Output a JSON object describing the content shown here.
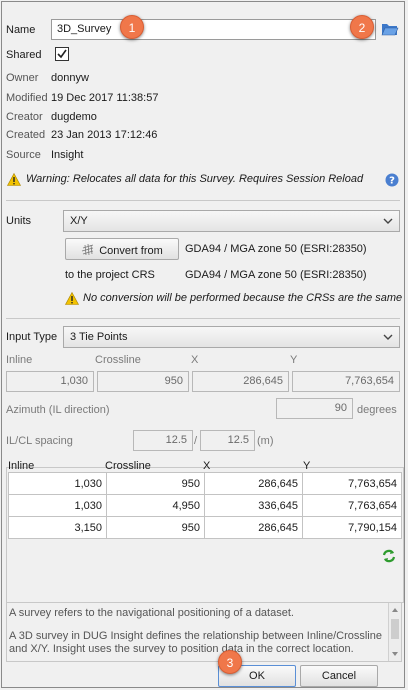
{
  "details": {
    "name_label": "Name",
    "name_value": "3D_Survey",
    "shared_label": "Shared",
    "owner_label": "Owner",
    "owner_value": "donnyw",
    "modified_label": "Modified",
    "modified_value": "19 Dec 2017 11:38:57",
    "creator_label": "Creator",
    "creator_value": "dugdemo",
    "created_label": "Created",
    "created_value": "23 Jan 2013 17:12:46",
    "source_label": "Source",
    "source_value": "Insight",
    "warning": "Warning: Relocates all data for this Survey. Requires Session Reload"
  },
  "units": {
    "label": "Units",
    "selected": "X/Y",
    "convert_button": "Convert from",
    "from_crs": "GDA94 / MGA zone 50 (ESRI:28350)",
    "to_label": "to the project CRS",
    "to_crs": "GDA94 / MGA zone 50 (ESRI:28350)",
    "note": "No conversion will be performed because the CRSs are the same"
  },
  "input_type": {
    "label": "Input Type",
    "selected": "3 Tie Points",
    "headers": [
      "Inline",
      "Crossline",
      "X",
      "Y"
    ],
    "values": [
      "1,030",
      "950",
      "286,645",
      "7,763,654"
    ],
    "azimuth_label": "Azimuth (IL direction)",
    "azimuth_value": "90",
    "azimuth_unit": "degrees",
    "spacing_label": "IL/CL spacing",
    "il_spacing": "12.5",
    "separator": "/",
    "cl_spacing": "12.5",
    "spacing_unit": "(m)"
  },
  "tie_points": {
    "headers": [
      "Inline",
      "Crossline",
      "X",
      "Y"
    ],
    "rows": [
      [
        "1,030",
        "950",
        "286,645",
        "7,763,654"
      ],
      [
        "1,030",
        "4,950",
        "336,645",
        "7,763,654"
      ],
      [
        "3,150",
        "950",
        "286,645",
        "7,790,154"
      ]
    ]
  },
  "description": {
    "p1": "A survey refers to the navigational positioning of a dataset.",
    "p2": "A 3D survey in DUG Insight defines the relationship between Inline/Crossline and X/Y. Insight uses the survey to position data in the correct location."
  },
  "footer": {
    "ok": "OK",
    "cancel": "Cancel"
  },
  "badges": [
    "1",
    "2",
    "3"
  ],
  "colors": {
    "badge": "#f0774a",
    "warning": "#f2c200",
    "help": "#4a7fd0",
    "refresh": "#2e9b2e"
  },
  "icons": {
    "open": "folder-open-icon",
    "warning": "warning-icon",
    "help": "help-icon",
    "convert": "globe-grid-icon",
    "refresh": "refresh-icon"
  }
}
